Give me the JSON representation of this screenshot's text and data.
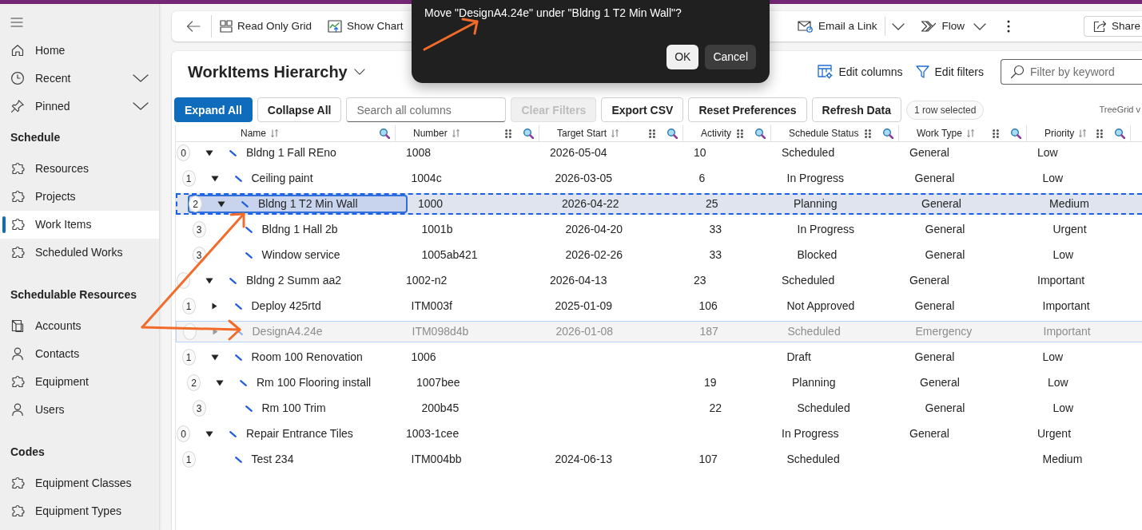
{
  "sidebar": {
    "items": [
      {
        "label": "Home",
        "selected": false
      },
      {
        "label": "Recent",
        "selected": false,
        "expanded": false
      },
      {
        "label": "Pinned",
        "selected": false,
        "expanded": false
      }
    ],
    "sections": [
      {
        "title": "Schedule",
        "items": [
          {
            "label": "Resources",
            "selected": false
          },
          {
            "label": "Projects",
            "selected": false
          },
          {
            "label": "Work Items",
            "selected": true
          },
          {
            "label": "Scheduled Works",
            "selected": false
          }
        ]
      },
      {
        "title": "Schedulable Resources",
        "items": [
          {
            "label": "Accounts",
            "selected": false
          },
          {
            "label": "Contacts",
            "selected": false
          },
          {
            "label": "Equipment",
            "selected": false
          },
          {
            "label": "Users",
            "selected": false
          }
        ]
      },
      {
        "title": "Codes",
        "items": [
          {
            "label": "Equipment Classes",
            "selected": false
          },
          {
            "label": "Equipment Types",
            "selected": false
          }
        ]
      }
    ]
  },
  "command_bar": {
    "left": [
      {
        "label": "Read Only Grid",
        "kind": "button"
      },
      {
        "label": "Show Chart",
        "kind": "button"
      }
    ],
    "right": [
      {
        "label": "Email a Link",
        "kind": "split"
      },
      {
        "label": "Flow",
        "kind": "menu"
      },
      {
        "kind": "more"
      }
    ],
    "share": {
      "label": "Share"
    }
  },
  "dialog": {
    "message": "Move \"DesignA4.24e\" under \"Bldng 1 T2 Min Wall\"?",
    "buttons": [
      {
        "label": "OK",
        "kind": "primary"
      },
      {
        "label": "Cancel",
        "kind": "secondary"
      }
    ]
  },
  "view": {
    "title": "WorkItems Hierarchy",
    "actions": [
      {
        "label": "Edit columns"
      },
      {
        "label": "Edit filters"
      }
    ],
    "filter": {
      "placeholder": "Filter by keyword"
    }
  },
  "grid_toolbar": {
    "items": [
      {
        "kind": "primary",
        "label": "Expand All",
        "disabled": false
      },
      {
        "kind": "default",
        "label": "Collapse All",
        "disabled": false
      },
      {
        "kind": "search",
        "placeholder": "Search all columns"
      },
      {
        "kind": "default",
        "label": "Clear Filters",
        "disabled": true
      },
      {
        "kind": "default",
        "label": "Export CSV",
        "disabled": false
      },
      {
        "kind": "default",
        "label": "Reset Preferences",
        "disabled": false
      },
      {
        "kind": "default",
        "label": "Refresh Data",
        "disabled": false
      }
    ],
    "selection_count": "1 row selected",
    "version_label": "TreeGrid v"
  },
  "grid": {
    "columns": [
      {
        "label": "Name",
        "sortable": true,
        "reorderable": false,
        "filterable": true
      },
      {
        "label": "Number",
        "sortable": true,
        "reorderable": true,
        "filterable": true
      },
      {
        "label": "Target Start",
        "sortable": true,
        "reorderable": true,
        "filterable": true
      },
      {
        "label": "Activity",
        "sortable": false,
        "reorderable": true,
        "filterable": true
      },
      {
        "label": "Schedule Status",
        "sortable": false,
        "reorderable": true,
        "filterable": true
      },
      {
        "label": "Work Type",
        "sortable": true,
        "reorderable": true,
        "filterable": true
      },
      {
        "label": "Priority",
        "sortable": true,
        "reorderable": true,
        "filterable": true
      }
    ],
    "rows": [
      {
        "badge": "0",
        "expanded": true,
        "selected": false,
        "drop_target": false,
        "dragging": false,
        "name": "Bldng 1 Fall REno",
        "number": "1008",
        "target_start": "2026-05-04",
        "activity": "10",
        "schedule_status": "Scheduled",
        "work_type": "General",
        "priority": "Low",
        "children": [
          {
            "badge": "1",
            "expanded": true,
            "selected": false,
            "drop_target": false,
            "dragging": false,
            "name": "Ceiling paint",
            "number": "1004c",
            "target_start": "2026-03-05",
            "activity": "6",
            "schedule_status": "In Progress",
            "work_type": "General",
            "priority": "Low",
            "children": [
              {
                "badge": "2",
                "expanded": true,
                "selected": true,
                "drop_target": true,
                "dragging": false,
                "name": "Bldng 1 T2 Min Wall",
                "number": "1000",
                "target_start": "2026-04-22",
                "activity": "25",
                "schedule_status": "Planning",
                "work_type": "General",
                "priority": "Medium",
                "children": [
                  {
                    "badge": "3",
                    "selected": false,
                    "drop_target": false,
                    "dragging": false,
                    "name": "Bldng 1 Hall 2b",
                    "number": "1001b",
                    "target_start": "2026-04-20",
                    "activity": "33",
                    "schedule_status": "In Progress",
                    "work_type": "General",
                    "priority": "Urgent"
                  },
                  {
                    "badge": "3",
                    "selected": false,
                    "drop_target": false,
                    "dragging": false,
                    "name": "Window service",
                    "number": "1005ab421",
                    "target_start": "2026-02-26",
                    "activity": "33",
                    "schedule_status": "Blocked",
                    "work_type": "General",
                    "priority": "Low"
                  }
                ]
              }
            ]
          }
        ]
      },
      {
        "expanded": true,
        "selected": false,
        "drop_target": false,
        "dragging": false,
        "name": "Bldng 2 Summ aa2",
        "number": "1002-n2",
        "target_start": "2026-04-13",
        "activity": "23",
        "schedule_status": "Scheduled",
        "work_type": "General",
        "priority": "Important",
        "children": [
          {
            "badge": "1",
            "expanded": false,
            "selected": false,
            "drop_target": false,
            "dragging": false,
            "name": "Deploy 425rtd",
            "number": "ITM003f",
            "target_start": "2025-01-09",
            "activity": "106",
            "schedule_status": "Not Approved",
            "work_type": "General",
            "priority": "Important"
          },
          {
            "expanded": false,
            "selected": false,
            "drop_target": false,
            "dragging": true,
            "name": "DesignA4.24e",
            "number": "ITM098d4b",
            "target_start": "2026-01-08",
            "activity": "187",
            "schedule_status": "Scheduled",
            "work_type": "Emergency",
            "priority": "Important"
          },
          {
            "badge": "1",
            "expanded": true,
            "selected": false,
            "drop_target": false,
            "dragging": false,
            "name": "Room 100 Renovation",
            "number": "1006",
            "schedule_status": "Draft",
            "work_type": "General",
            "priority": "Low",
            "children": [
              {
                "badge": "2",
                "expanded": true,
                "selected": false,
                "drop_target": false,
                "dragging": false,
                "name": "Rm 100 Flooring install",
                "number": "1007bee",
                "activity": "19",
                "schedule_status": "Planning",
                "work_type": "General",
                "priority": "Low",
                "children": [
                  {
                    "badge": "3",
                    "selected": false,
                    "drop_target": false,
                    "dragging": false,
                    "name": "Rm 100 Trim",
                    "number": "200b45",
                    "activity": "22",
                    "schedule_status": "Scheduled",
                    "work_type": "General",
                    "priority": "Low"
                  }
                ]
              }
            ]
          }
        ]
      },
      {
        "badge": "0",
        "expanded": true,
        "selected": false,
        "drop_target": false,
        "dragging": false,
        "name": "Repair Entrance Tiles",
        "number": "1003-1cee",
        "schedule_status": "In Progress",
        "work_type": "General",
        "priority": "Urgent",
        "children": [
          {
            "badge": "1",
            "selected": false,
            "drop_target": false,
            "dragging": false,
            "name": "Test 234",
            "number": "ITM004bb",
            "target_start": "2024-06-13",
            "activity": "107",
            "schedule_status": "Scheduled",
            "priority": "Medium"
          }
        ]
      }
    ]
  }
}
